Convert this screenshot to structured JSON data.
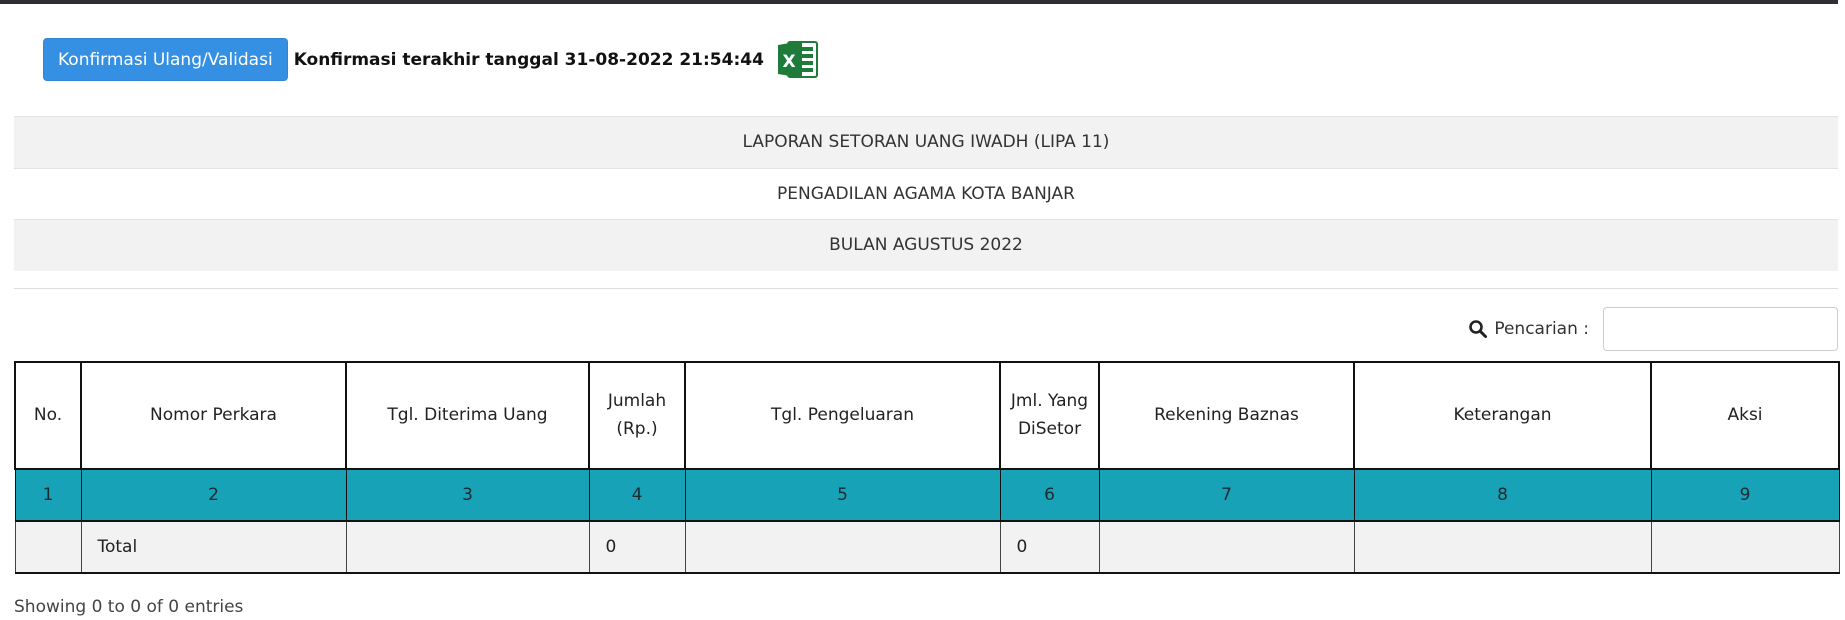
{
  "toolbar": {
    "validate_button": "Konfirmasi Ulang/Validasi",
    "last_confirm": "Konfirmasi terakhir tanggal 31-08-2022 21:54:44",
    "export_icon": "excel-icon"
  },
  "titles": [
    "LAPORAN SETORAN UANG IWADH (LIPA 11)",
    "PENGADILAN AGAMA KOTA BANJAR",
    "BULAN AGUSTUS 2022"
  ],
  "search": {
    "label": "Pencarian :",
    "value": "",
    "placeholder": ""
  },
  "table": {
    "headers": [
      "No.",
      "Nomor Perkara",
      "Tgl. Diterima Uang",
      "Jumlah (Rp.)",
      "Tgl. Pengeluaran",
      "Jml. Yang DiSetor",
      "Rekening Baznas",
      "Keterangan",
      "Aksi"
    ],
    "numbering": [
      "1",
      "2",
      "3",
      "4",
      "5",
      "6",
      "7",
      "8",
      "9"
    ],
    "total_row": [
      "",
      "Total",
      "",
      "0",
      "",
      "0",
      "",
      "",
      ""
    ]
  },
  "footer": {
    "info": "Showing 0 to 0 of 0 entries"
  },
  "colors": {
    "accent": "#3590e3",
    "numbering_row": "#17a2b8",
    "excel_green": "#1e7b3a"
  }
}
